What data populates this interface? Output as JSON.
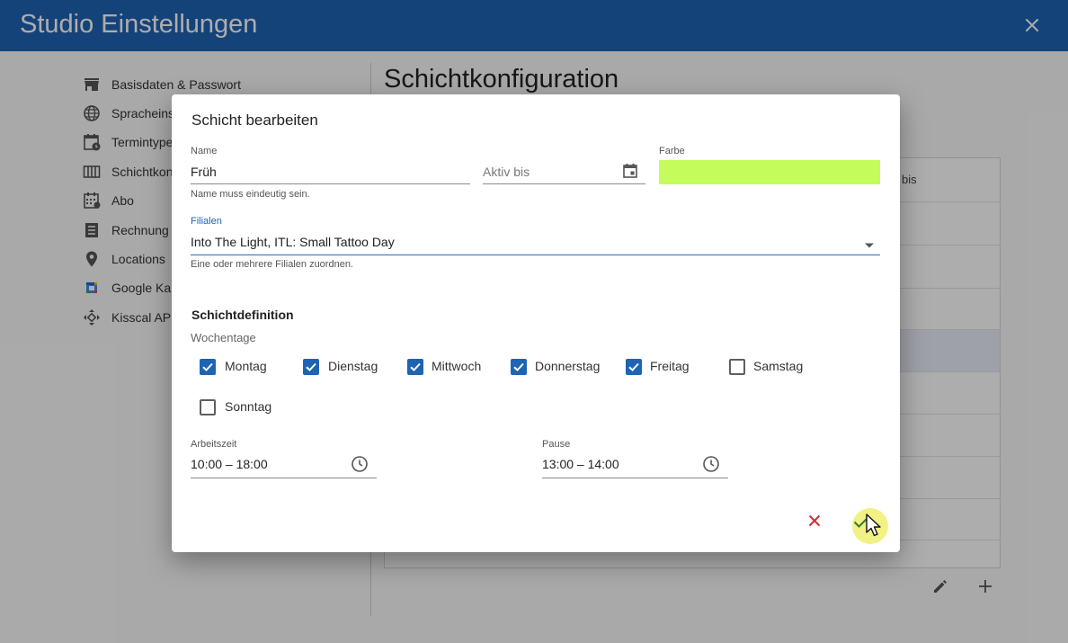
{
  "app": {
    "title": "Studio Einstellungen"
  },
  "sidebar": {
    "items": [
      {
        "label": "Basisdaten & Passwort",
        "icon": "store-icon"
      },
      {
        "label": "Spracheins",
        "icon": "globe-icon"
      },
      {
        "label": "Termintype",
        "icon": "calendar-clock-icon"
      },
      {
        "label": "Schichtkon",
        "icon": "columns-icon"
      },
      {
        "label": "Abo",
        "icon": "calendar-grid-icon"
      },
      {
        "label": "Rechnung",
        "icon": "receipt-icon"
      },
      {
        "label": "Locations",
        "icon": "location-pin-icon"
      },
      {
        "label": "Google Ka",
        "icon": "google-calendar-icon"
      },
      {
        "label": "Kisscal AP",
        "icon": "api-arrows-icon"
      }
    ]
  },
  "page": {
    "title": "Schichtkonfiguration",
    "table_header_partial": "bis"
  },
  "dialog": {
    "title": "Schicht bearbeiten",
    "name": {
      "label": "Name",
      "value": "Früh",
      "hint": "Name muss eindeutig sein."
    },
    "active_until": {
      "placeholder": "Aktiv bis"
    },
    "color": {
      "label": "Farbe",
      "value": "#c3fc5b"
    },
    "branches": {
      "label": "Filialen",
      "value": "Into The Light, ITL: Small Tattoo Day",
      "hint": "Eine oder mehrere Filialen zuordnen."
    },
    "section_title": "Schichtdefinition",
    "weekdays_label": "Wochentage",
    "weekdays": [
      {
        "label": "Montag",
        "checked": true
      },
      {
        "label": "Dienstag",
        "checked": true
      },
      {
        "label": "Mittwoch",
        "checked": true
      },
      {
        "label": "Donnerstag",
        "checked": true
      },
      {
        "label": "Freitag",
        "checked": true
      },
      {
        "label": "Samstag",
        "checked": false
      },
      {
        "label": "Sonntag",
        "checked": false
      }
    ],
    "working_time": {
      "label": "Arbeitszeit",
      "value": "10:00 – 18:00"
    },
    "break_time": {
      "label": "Pause",
      "value": "13:00 – 14:00"
    }
  },
  "colors": {
    "primary": "#1e64b4",
    "cancel": "#d32f2f",
    "confirm": "#2e7d32",
    "swatch": "#c3fc5b"
  }
}
